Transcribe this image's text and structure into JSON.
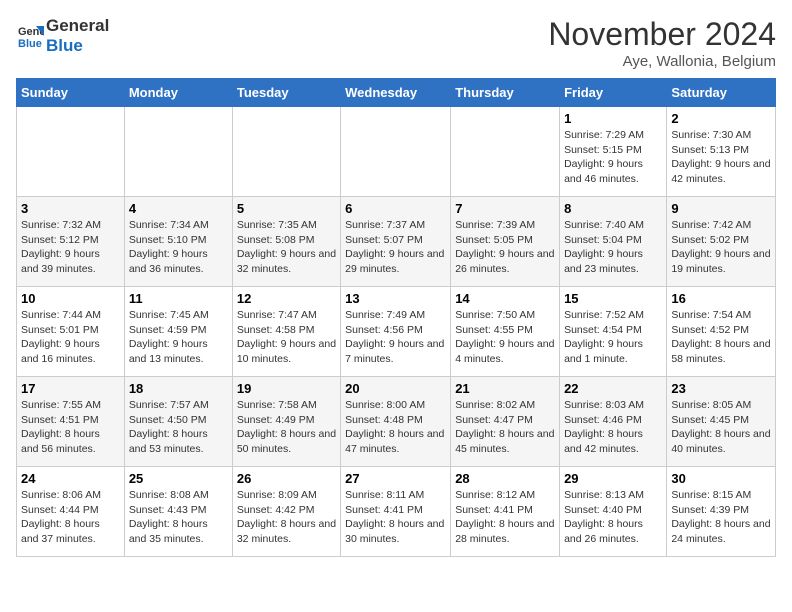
{
  "header": {
    "logo_line1": "General",
    "logo_line2": "Blue",
    "month": "November 2024",
    "location": "Aye, Wallonia, Belgium"
  },
  "weekdays": [
    "Sunday",
    "Monday",
    "Tuesday",
    "Wednesday",
    "Thursday",
    "Friday",
    "Saturday"
  ],
  "weeks": [
    [
      {
        "day": "",
        "info": ""
      },
      {
        "day": "",
        "info": ""
      },
      {
        "day": "",
        "info": ""
      },
      {
        "day": "",
        "info": ""
      },
      {
        "day": "",
        "info": ""
      },
      {
        "day": "1",
        "info": "Sunrise: 7:29 AM\nSunset: 5:15 PM\nDaylight: 9 hours and 46 minutes."
      },
      {
        "day": "2",
        "info": "Sunrise: 7:30 AM\nSunset: 5:13 PM\nDaylight: 9 hours and 42 minutes."
      }
    ],
    [
      {
        "day": "3",
        "info": "Sunrise: 7:32 AM\nSunset: 5:12 PM\nDaylight: 9 hours and 39 minutes."
      },
      {
        "day": "4",
        "info": "Sunrise: 7:34 AM\nSunset: 5:10 PM\nDaylight: 9 hours and 36 minutes."
      },
      {
        "day": "5",
        "info": "Sunrise: 7:35 AM\nSunset: 5:08 PM\nDaylight: 9 hours and 32 minutes."
      },
      {
        "day": "6",
        "info": "Sunrise: 7:37 AM\nSunset: 5:07 PM\nDaylight: 9 hours and 29 minutes."
      },
      {
        "day": "7",
        "info": "Sunrise: 7:39 AM\nSunset: 5:05 PM\nDaylight: 9 hours and 26 minutes."
      },
      {
        "day": "8",
        "info": "Sunrise: 7:40 AM\nSunset: 5:04 PM\nDaylight: 9 hours and 23 minutes."
      },
      {
        "day": "9",
        "info": "Sunrise: 7:42 AM\nSunset: 5:02 PM\nDaylight: 9 hours and 19 minutes."
      }
    ],
    [
      {
        "day": "10",
        "info": "Sunrise: 7:44 AM\nSunset: 5:01 PM\nDaylight: 9 hours and 16 minutes."
      },
      {
        "day": "11",
        "info": "Sunrise: 7:45 AM\nSunset: 4:59 PM\nDaylight: 9 hours and 13 minutes."
      },
      {
        "day": "12",
        "info": "Sunrise: 7:47 AM\nSunset: 4:58 PM\nDaylight: 9 hours and 10 minutes."
      },
      {
        "day": "13",
        "info": "Sunrise: 7:49 AM\nSunset: 4:56 PM\nDaylight: 9 hours and 7 minutes."
      },
      {
        "day": "14",
        "info": "Sunrise: 7:50 AM\nSunset: 4:55 PM\nDaylight: 9 hours and 4 minutes."
      },
      {
        "day": "15",
        "info": "Sunrise: 7:52 AM\nSunset: 4:54 PM\nDaylight: 9 hours and 1 minute."
      },
      {
        "day": "16",
        "info": "Sunrise: 7:54 AM\nSunset: 4:52 PM\nDaylight: 8 hours and 58 minutes."
      }
    ],
    [
      {
        "day": "17",
        "info": "Sunrise: 7:55 AM\nSunset: 4:51 PM\nDaylight: 8 hours and 56 minutes."
      },
      {
        "day": "18",
        "info": "Sunrise: 7:57 AM\nSunset: 4:50 PM\nDaylight: 8 hours and 53 minutes."
      },
      {
        "day": "19",
        "info": "Sunrise: 7:58 AM\nSunset: 4:49 PM\nDaylight: 8 hours and 50 minutes."
      },
      {
        "day": "20",
        "info": "Sunrise: 8:00 AM\nSunset: 4:48 PM\nDaylight: 8 hours and 47 minutes."
      },
      {
        "day": "21",
        "info": "Sunrise: 8:02 AM\nSunset: 4:47 PM\nDaylight: 8 hours and 45 minutes."
      },
      {
        "day": "22",
        "info": "Sunrise: 8:03 AM\nSunset: 4:46 PM\nDaylight: 8 hours and 42 minutes."
      },
      {
        "day": "23",
        "info": "Sunrise: 8:05 AM\nSunset: 4:45 PM\nDaylight: 8 hours and 40 minutes."
      }
    ],
    [
      {
        "day": "24",
        "info": "Sunrise: 8:06 AM\nSunset: 4:44 PM\nDaylight: 8 hours and 37 minutes."
      },
      {
        "day": "25",
        "info": "Sunrise: 8:08 AM\nSunset: 4:43 PM\nDaylight: 8 hours and 35 minutes."
      },
      {
        "day": "26",
        "info": "Sunrise: 8:09 AM\nSunset: 4:42 PM\nDaylight: 8 hours and 32 minutes."
      },
      {
        "day": "27",
        "info": "Sunrise: 8:11 AM\nSunset: 4:41 PM\nDaylight: 8 hours and 30 minutes."
      },
      {
        "day": "28",
        "info": "Sunrise: 8:12 AM\nSunset: 4:41 PM\nDaylight: 8 hours and 28 minutes."
      },
      {
        "day": "29",
        "info": "Sunrise: 8:13 AM\nSunset: 4:40 PM\nDaylight: 8 hours and 26 minutes."
      },
      {
        "day": "30",
        "info": "Sunrise: 8:15 AM\nSunset: 4:39 PM\nDaylight: 8 hours and 24 minutes."
      }
    ]
  ]
}
